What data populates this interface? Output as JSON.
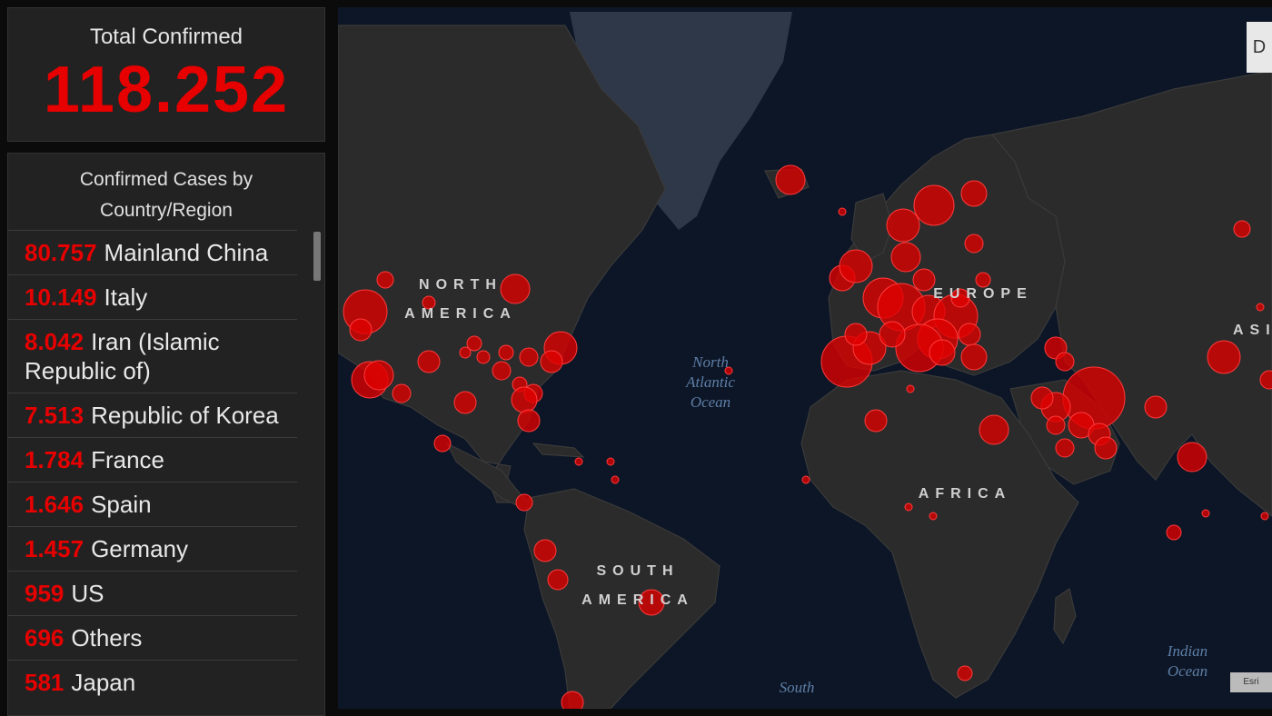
{
  "total": {
    "label": "Total Confirmed",
    "value": "118.252"
  },
  "list": {
    "header": "Confirmed Cases by Country/Region",
    "items": [
      {
        "count": "80.757",
        "name": "Mainland China"
      },
      {
        "count": "10.149",
        "name": "Italy"
      },
      {
        "count": "8.042",
        "name": "Iran (Islamic Republic of)"
      },
      {
        "count": "7.513",
        "name": "Republic of Korea"
      },
      {
        "count": "1.784",
        "name": "France"
      },
      {
        "count": "1.646",
        "name": "Spain"
      },
      {
        "count": "1.457",
        "name": "Germany"
      },
      {
        "count": "959",
        "name": "US"
      },
      {
        "count": "696",
        "name": "Others"
      },
      {
        "count": "581",
        "name": "Japan"
      }
    ]
  },
  "map": {
    "labels": {
      "north_america": "NORTH AMERICA",
      "south_america": "SOUTH AMERICA",
      "europe": "EUROPE",
      "africa": "AFRICA",
      "asia": "ASIA"
    },
    "oceans": {
      "north_atlantic": "North Atlantic Ocean",
      "indian": "Indian Ocean",
      "south": "South"
    },
    "corner_button": "D",
    "attribution": "Esri"
  },
  "colors": {
    "case_marker": "#e00000",
    "panel": "#222222",
    "ocean": "#0d1626",
    "land": "#2b2b2b"
  }
}
